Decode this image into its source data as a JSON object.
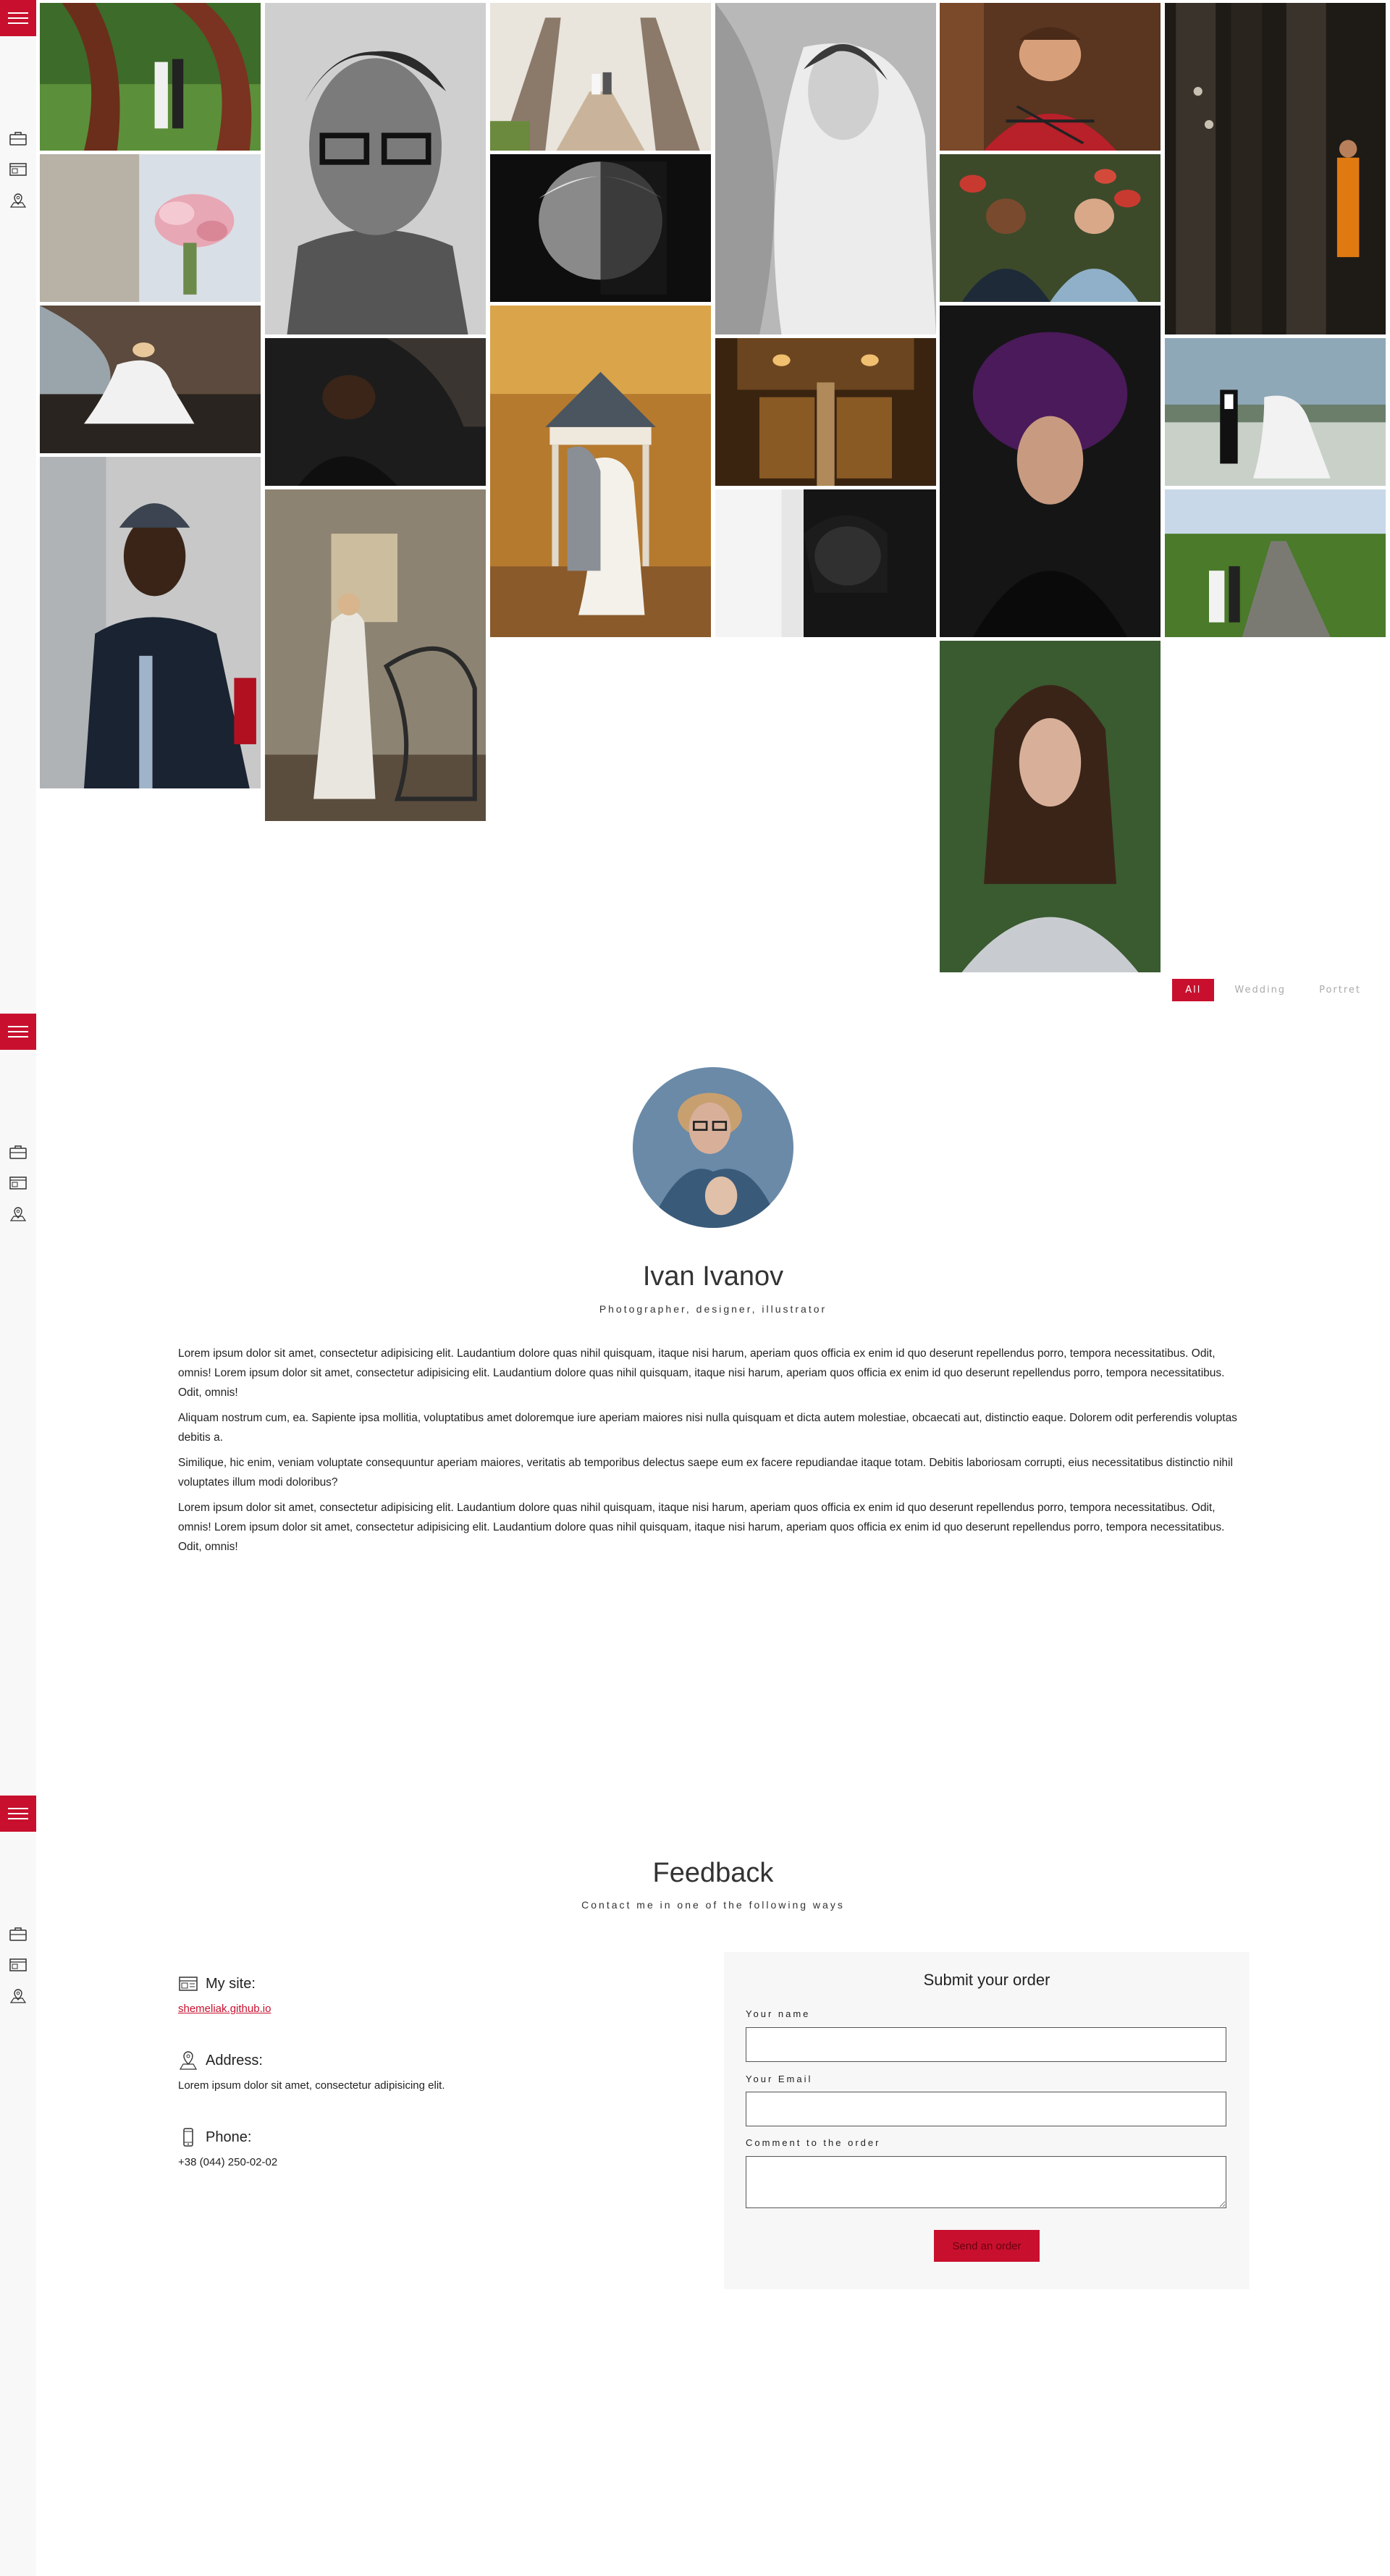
{
  "gallery": {
    "filters": [
      "All",
      "Wedding",
      "Portret"
    ],
    "active_filter": "All"
  },
  "about": {
    "name": "Ivan Ivanov",
    "subtitle": "Photographer, designer, illustrator",
    "paragraphs": [
      "Lorem ipsum dolor sit amet, consectetur adipisicing elit. Laudantium dolore quas nihil quisquam, itaque nisi harum, aperiam quos officia ex enim id quo deserunt repellendus porro, tempora necessitatibus. Odit, omnis! Lorem ipsum dolor sit amet, consectetur adipisicing elit. Laudantium dolore quas nihil quisquam, itaque nisi harum, aperiam quos officia ex enim id quo deserunt repellendus porro, tempora necessitatibus. Odit, omnis!",
      "Aliquam nostrum cum, ea. Sapiente ipsa mollitia, voluptatibus amet doloremque iure aperiam maiores nisi nulla quisquam et dicta autem molestiae, obcaecati aut, distinctio eaque. Dolorem odit perferendis voluptas debitis a.",
      "Similique, hic enim, veniam voluptate consequuntur aperiam maiores, veritatis ab temporibus delectus saepe eum ex facere repudiandae itaque totam. Debitis laboriosam corrupti, eius necessitatibus distinctio nihil voluptates illum modi doloribus?",
      "Lorem ipsum dolor sit amet, consectetur adipisicing elit. Laudantium dolore quas nihil quisquam, itaque nisi harum, aperiam quos officia ex enim id quo deserunt repellendus porro, tempora necessitatibus. Odit, omnis! Lorem ipsum dolor sit amet, consectetur adipisicing elit. Laudantium dolore quas nihil quisquam, itaque nisi harum, aperiam quos officia ex enim id quo deserunt repellendus porro, tempora necessitatibus. Odit, omnis!"
    ]
  },
  "feedback": {
    "title": "Feedback",
    "subtitle": "Contact me in one of the following ways",
    "site_label": "My site:",
    "site_value": "shemeliak.github.io",
    "address_label": "Address:",
    "address_value": "Lorem ipsum dolor sit amet, consectetur adipisicing elit.",
    "phone_label": "Phone:",
    "phone_value": "+38 (044) 250-02-02",
    "form": {
      "title": "Submit your order",
      "name_label": "Your name",
      "email_label": "Your Email",
      "comment_label": "Comment to the order",
      "send_label": "Send an order"
    }
  },
  "colors": {
    "accent": "#c8102e",
    "sidebar": "#f8f8f8",
    "form_bg": "#f7f7f7"
  },
  "icons": [
    "menu-icon",
    "briefcase-icon",
    "browser-icon",
    "map-pin-icon",
    "phone-icon"
  ]
}
